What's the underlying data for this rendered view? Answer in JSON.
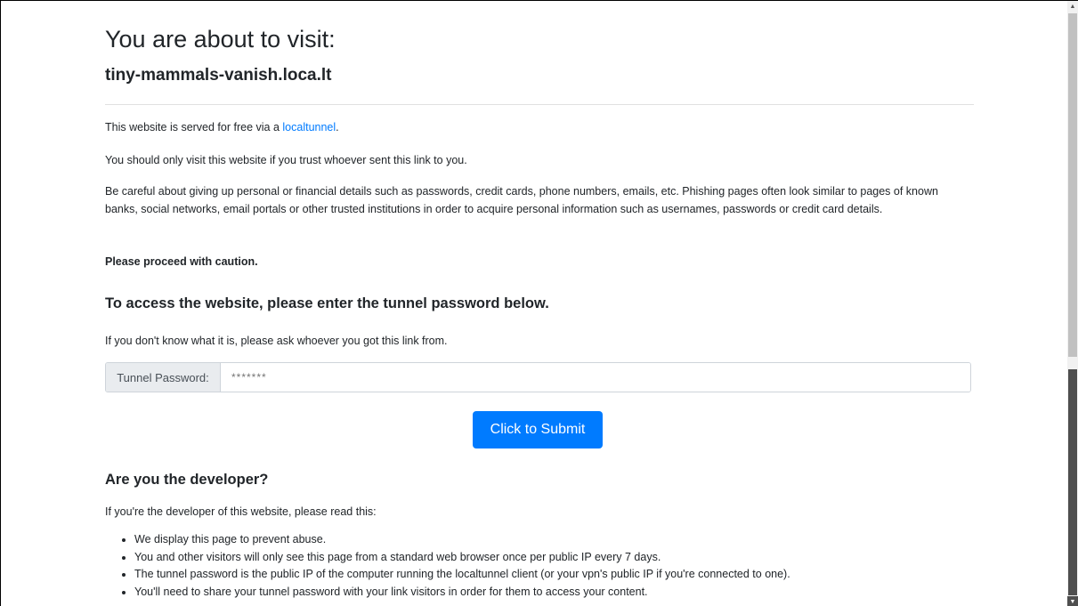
{
  "header": {
    "title": "You are about to visit:",
    "hostname": "tiny-mammals-vanish.loca.lt"
  },
  "intro": {
    "p1_prefix": "This website is served for free via a ",
    "p1_link": "localtunnel",
    "p1_suffix": ".",
    "p2": "You should only visit this website if you trust whoever sent this link to you.",
    "p3": "Be careful about giving up personal or financial details such as passwords, credit cards, phone numbers, emails, etc. Phishing pages often look similar to pages of known banks, social networks, email portals or other trusted institutions in order to acquire personal information such as usernames, passwords or credit card details.",
    "p4": "Please proceed with caution."
  },
  "access": {
    "heading": "To access the website, please enter the tunnel password below.",
    "subtext": "If you don't know what it is, please ask whoever you got this link from.",
    "password_label": "Tunnel Password:",
    "password_placeholder": "*******",
    "submit_label": "Click to Submit"
  },
  "developer": {
    "heading": "Are you the developer?",
    "subtext": "If you're the developer of this website, please read this:",
    "items": [
      "We display this page to prevent abuse.",
      "You and other visitors will only see this page from a standard web browser once per public IP every 7 days.",
      "The tunnel password is the public IP of the computer running the localtunnel client (or your vpn's public IP if you're connected to one).",
      "You'll need to share your tunnel password with your link visitors in order for them to access your content."
    ]
  },
  "colors": {
    "link": "#007bff",
    "button": "#007bff",
    "text": "#212529"
  }
}
